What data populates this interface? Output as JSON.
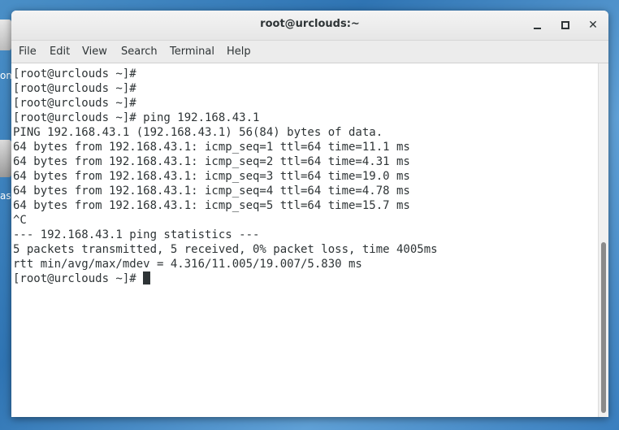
{
  "desktop": {
    "icon_a_label": "om",
    "icon_b_label": "as"
  },
  "window": {
    "title": "root@urclouds:~",
    "buttons": {
      "minimize": "minimize",
      "maximize": "maximize",
      "close": "✕"
    }
  },
  "menu": {
    "items": [
      "File",
      "Edit",
      "View",
      "Search",
      "Terminal",
      "Help"
    ]
  },
  "terminal": {
    "lines": [
      "[root@urclouds ~]#",
      "[root@urclouds ~]#",
      "[root@urclouds ~]#",
      "[root@urclouds ~]# ping 192.168.43.1",
      "PING 192.168.43.1 (192.168.43.1) 56(84) bytes of data.",
      "64 bytes from 192.168.43.1: icmp_seq=1 ttl=64 time=11.1 ms",
      "64 bytes from 192.168.43.1: icmp_seq=2 ttl=64 time=4.31 ms",
      "64 bytes from 192.168.43.1: icmp_seq=3 ttl=64 time=19.0 ms",
      "64 bytes from 192.168.43.1: icmp_seq=4 ttl=64 time=4.78 ms",
      "64 bytes from 192.168.43.1: icmp_seq=5 ttl=64 time=15.7 ms",
      "^C",
      "--- 192.168.43.1 ping statistics ---",
      "5 packets transmitted, 5 received, 0% packet loss, time 4005ms",
      "rtt min/avg/max/mdev = 4.316/11.005/19.007/5.830 ms"
    ],
    "prompt": "[root@urclouds ~]# "
  },
  "colors": {
    "terminal_bg": "#ffffff",
    "terminal_fg": "#2e3436",
    "desktop_bg": "#3a7fbf"
  }
}
